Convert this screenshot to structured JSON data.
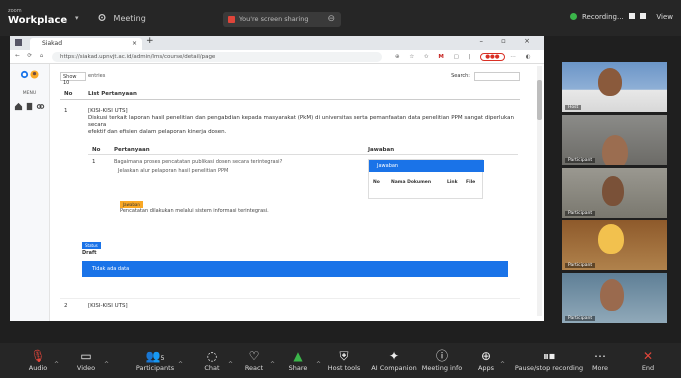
{
  "app": {
    "brand_small": "zoom",
    "brand_big": "Workplace",
    "meeting_label": "Meeting",
    "share_label": "You're screen sharing",
    "recording_label": "Recording...",
    "view_label": "View"
  },
  "browser": {
    "tab_title": "Siakad",
    "url": "https://siakad.upnvjt.ac.id/admin/lms/course/detail/page"
  },
  "page": {
    "sidebar_label": "MENU",
    "show_label": "Show",
    "show_value": "10",
    "entries_label": "entries",
    "search_label": "Search:",
    "col_no": "No",
    "col_question": "List Pertanyaan",
    "q1_no": "1",
    "q1_title": "[KISI-KISI UTS]",
    "q1_text_1": "Diskusi terkait laporan hasil penelitian dan pengabdian kepada masyarakat (PkM) di universitas serta pemanfaatan data penelitian PPM sangat diperlukan secara",
    "q1_text_2": "efektif dan efisien dalam pelaporan kinerja dosen.",
    "inner_col_no": "No",
    "inner_col_question": "Pertanyaan",
    "inner_col_answer": "Jawaban",
    "inner_q1": "Bagaimana proses pencatatan publikasi dosen secara terintegrasi?",
    "inner_q2": "Jelaskan alur pelaporan hasil penelitian PPM",
    "inner_no": "1",
    "subbox_title": "Jawaban",
    "sub_no": "No",
    "sub_name": "Nama Dokumen",
    "sub_link": "Link",
    "sub_file": "File",
    "answer_tag": "Jawaban",
    "answer_text": "Pencatatan dilakukan melalui sistem informasi terintegrasi.",
    "status_tag": "Status",
    "draft_label": "Draft",
    "bluebar_text": "Tidak ada data",
    "q2_no": "2",
    "q2_title": "[KISI-KISI UTS]"
  },
  "participants": [
    {
      "name": "Host"
    },
    {
      "name": "Participant"
    },
    {
      "name": "Participant"
    },
    {
      "name": "Participant"
    },
    {
      "name": "Participant"
    }
  ],
  "toolbar": {
    "audio": "Audio",
    "video": "Video",
    "participants": "Participants",
    "participants_count": "5",
    "chat": "Chat",
    "react": "React",
    "share": "Share",
    "host_tools": "Host tools",
    "ai_companion": "AI Companion",
    "meeting_info": "Meeting info",
    "apps": "Apps",
    "pause_recording": "Pause/stop recording",
    "more": "More",
    "end": "End"
  }
}
